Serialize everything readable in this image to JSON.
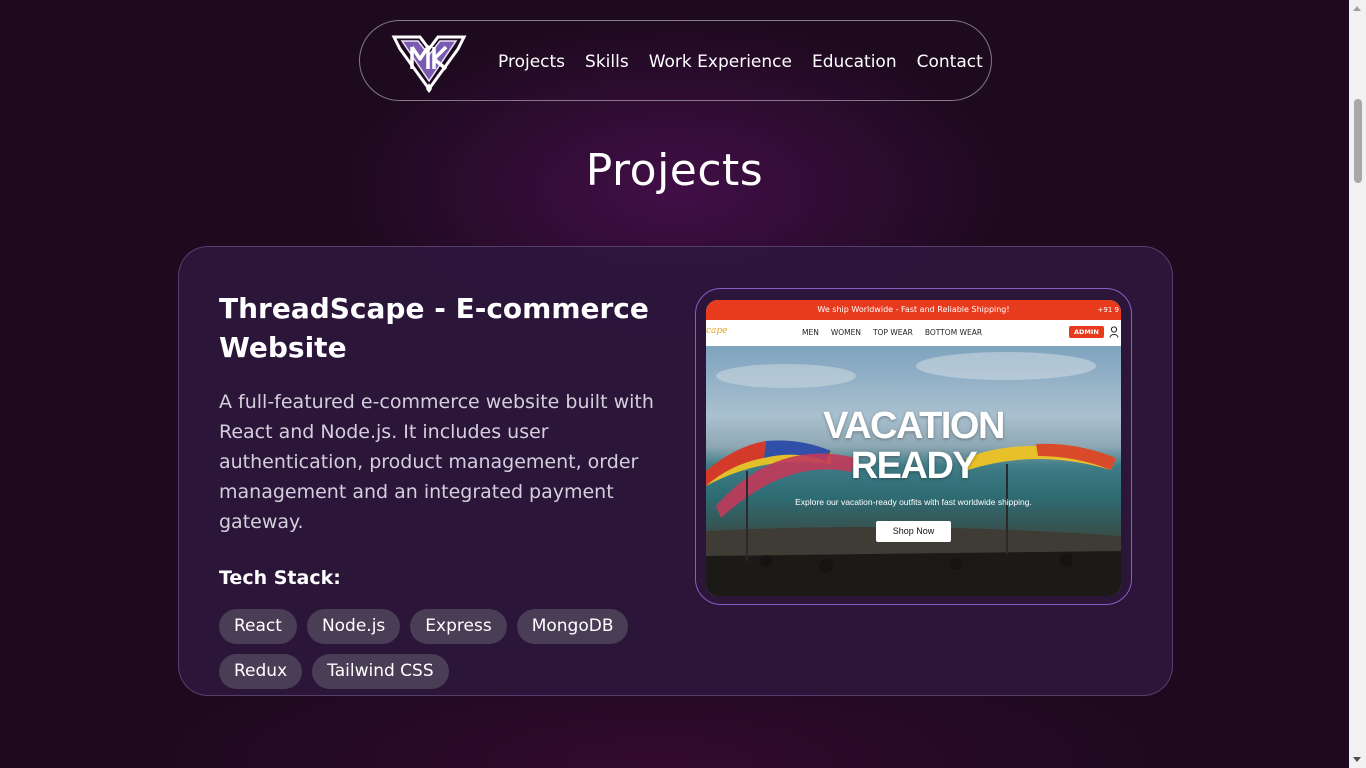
{
  "nav": {
    "logo_text": "MK",
    "links": [
      "Projects",
      "Skills",
      "Work Experience",
      "Education",
      "Contact"
    ]
  },
  "page_title": "Projects",
  "project": {
    "title": "ThreadScape - E-commerce Website",
    "description": "A full-featured e-commerce website built with React and Node.js. It includes user authentication, product management, order management and an integrated payment gateway.",
    "tech_label": "Tech Stack:",
    "tech_stack": [
      "React",
      "Node.js",
      "Express",
      "MongoDB",
      "Redux",
      "Tailwind CSS"
    ],
    "preview": {
      "banner": "We ship Worldwide - Fast and Reliable Shipping!",
      "banner_phone": "+91 9",
      "brand": "cape",
      "menu": [
        "MEN",
        "WOMEN",
        "TOP WEAR",
        "BOTTOM WEAR"
      ],
      "admin_label": "ADMIN",
      "hero_title_line1": "VACATION",
      "hero_title_line2": "READY",
      "hero_subtitle": "Explore our vacation-ready outfits with fast worldwide shipping.",
      "hero_button": "Shop Now"
    }
  },
  "colors": {
    "background": "#1e0a1f",
    "card": "#2c173c",
    "tag": "#4a3d56",
    "preview_border": "#8a5cc7",
    "banner": "#e83a1d"
  }
}
